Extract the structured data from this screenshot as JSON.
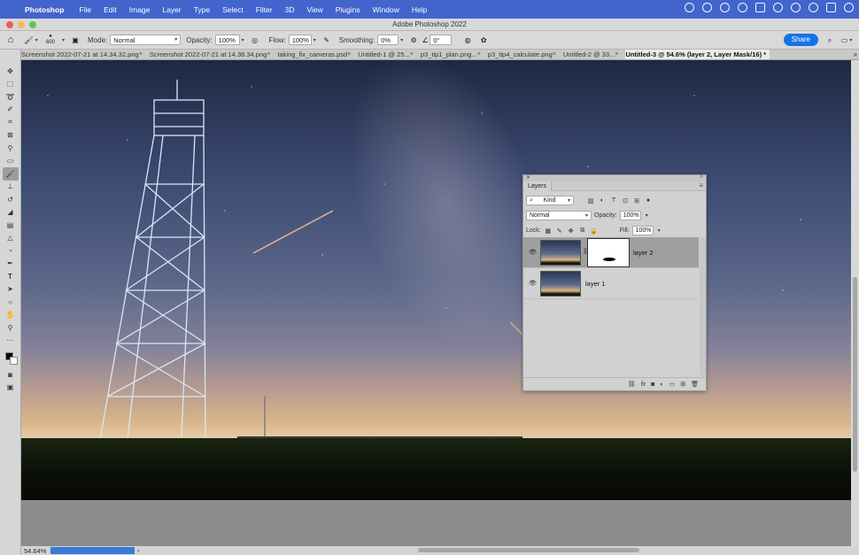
{
  "menubar": {
    "app": "Photoshop",
    "items": [
      "File",
      "Edit",
      "Image",
      "Layer",
      "Type",
      "Select",
      "Filter",
      "3D",
      "View",
      "Plugins",
      "Window",
      "Help"
    ]
  },
  "window": {
    "title": "Adobe Photoshop 2022"
  },
  "options": {
    "brush_size": "600",
    "mode_label": "Mode:",
    "mode_value": "Normal",
    "opacity_label": "Opacity:",
    "opacity_value": "100%",
    "flow_label": "Flow:",
    "flow_value": "100%",
    "smoothing_label": "Smoothing:",
    "smoothing_value": "0%",
    "angle_value": "0°",
    "share_label": "Share"
  },
  "tabs": [
    {
      "label": "Screenshot 2022-07-21 at 14.34.32.png"
    },
    {
      "label": "Screenshot 2022-07-21 at 14.38.34.png"
    },
    {
      "label": "taking_fix_cameras.psd"
    },
    {
      "label": "Untitled-1 @ 25..."
    },
    {
      "label": "p3_tip1_plan.png..."
    },
    {
      "label": "p3_tip4_calculate.png"
    },
    {
      "label": "Untitled-2 @ 33..."
    },
    {
      "label": "Untitled-3 @ 54.6% (layer 2, Layer Mask/16) *"
    }
  ],
  "status": {
    "zoom": "54.64%",
    "arrow": "›"
  },
  "layers_panel": {
    "tab": "Layers",
    "filter_value": "Kind",
    "blend_mode": "Normal",
    "opacity_label": "Opacity:",
    "opacity_value": "100%",
    "lock_label": "Lock:",
    "fill_label": "Fill:",
    "fill_value": "100%",
    "layers": [
      {
        "name": "layer 2",
        "has_mask": true,
        "selected": true,
        "visible": true
      },
      {
        "name": "layer 1",
        "has_mask": false,
        "selected": false,
        "visible": true
      }
    ],
    "footer_fx": "fx"
  },
  "icons": {
    "toolbar": [
      "move-icon",
      "marquee-icon",
      "lasso-icon",
      "quick-select-icon",
      "crop-icon",
      "frame-icon",
      "eyedropper-icon",
      "spot-heal-icon",
      "brush-icon",
      "clone-stamp-icon",
      "history-brush-icon",
      "eraser-icon",
      "gradient-icon",
      "blur-icon",
      "dodge-icon",
      "pen-icon",
      "type-icon",
      "path-select-icon",
      "ellipse-icon",
      "hand-icon",
      "zoom-icon",
      "more-tools-icon"
    ]
  },
  "colors": {
    "menubar_bg": "#4264cc",
    "share_button": "#1473e6",
    "progress": "#3a79d8",
    "foreground_swatch": "#000000",
    "background_swatch": "#ffffff"
  }
}
